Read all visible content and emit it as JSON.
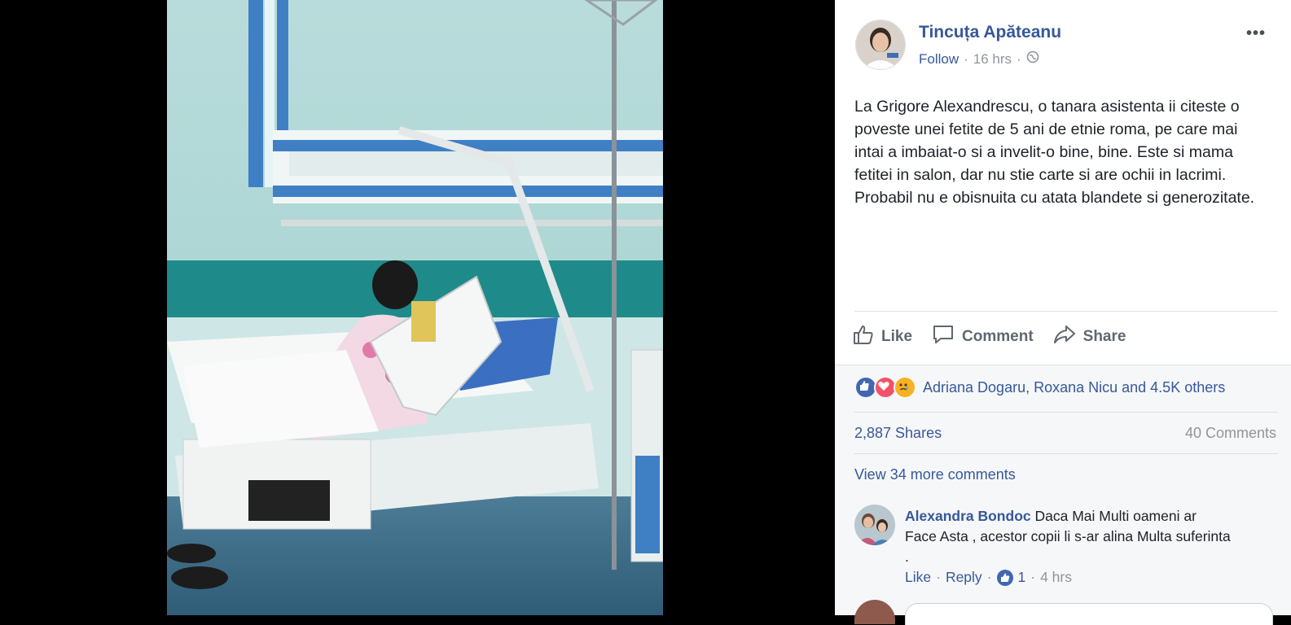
{
  "post": {
    "author": "Tincuța Apăteanu",
    "follow": "Follow",
    "sep1": "·",
    "time": "16 hrs",
    "sep2": "·",
    "text": "La Grigore Alexandrescu, o tanara asistenta ii citeste o poveste unei fetite de 5 ani de etnie roma, pe care mai intai a imbaiat-o si a invelit-o bine, bine. Este si mama fetitei in salon, dar nu stie carte si are ochii in lacrimi. Probabil nu e obisnuita cu atata blandete si generozitate.",
    "more_label": "•••"
  },
  "actions": {
    "like": "Like",
    "comment": "Comment",
    "share": "Share"
  },
  "stats": {
    "reactions_text": "Adriana Dogaru, Roxana Nicu and 4.5K others",
    "shares": "2,887 Shares",
    "comments": "40 Comments"
  },
  "comments": {
    "view_more": "View 34 more comments",
    "items": [
      {
        "name": "Alexandra Bondoc",
        "text": "Daca Mai Multi oameni ar Face Asta , acestor copii li s-ar alina Multa suferinta .",
        "like": "Like",
        "reply": "Reply",
        "sep": "·",
        "likes": "1",
        "time": "4 hrs"
      }
    ]
  },
  "icons": {
    "privacy": "globe-icon",
    "reaction_types": [
      "like-reaction-icon",
      "love-reaction-icon",
      "sad-reaction-icon"
    ]
  },
  "colors": {
    "link": "#365899",
    "like_blue": "#4267b2",
    "love_red": "#f25268",
    "sad_yellow": "#f7b125"
  }
}
